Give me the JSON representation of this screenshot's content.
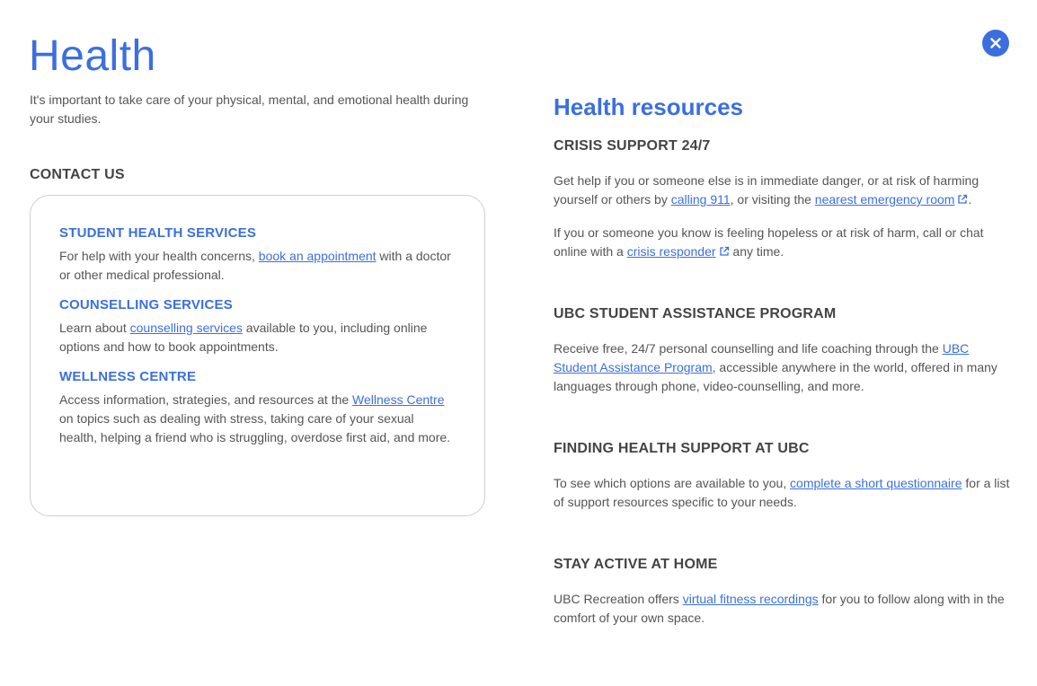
{
  "header": {
    "title": "Health",
    "close_icon": "close-icon"
  },
  "intro": "It's important to take care of your physical, mental, and emotional health during your studies.",
  "contact": {
    "heading": "CONTACT US",
    "services": [
      {
        "title": "STUDENT HEALTH SERVICES",
        "before": "For help with your health concerns, ",
        "link": "book an appointment",
        "after": " with a doctor or other medical professional."
      },
      {
        "title": "COUNSELLING SERVICES",
        "before": "Learn about ",
        "link": "counselling services",
        "after": " available to you, including online options and how to book appointments."
      },
      {
        "title": "WELLNESS CENTRE",
        "before": "Access information, strategies, and resources at the ",
        "link": "Wellness Centre",
        "after": " on topics such as dealing with stress, taking care of your sexual health, helping a friend who is struggling, overdose first aid, and more."
      }
    ]
  },
  "resources": {
    "title": "Health resources",
    "crisis": {
      "title": "CRISIS SUPPORT 24/7",
      "p1_before": "Get help if you or someone else is in immediate danger, or at risk of harming yourself or others by ",
      "p1_link1": "calling 911",
      "p1_mid": ", or visiting the ",
      "p1_link2": "nearest emergency room",
      "p1_after": ".",
      "p2_before": "If you or someone you know is feeling hopeless or at risk of harm, call or chat online with a ",
      "p2_link": "crisis responder",
      "p2_after": " any time."
    },
    "sap": {
      "title": "UBC STUDENT ASSISTANCE PROGRAM",
      "before": "Receive free, 24/7 personal counselling and life coaching through the ",
      "link": "UBC Student Assistance Program",
      "after": ", accessible anywhere in the world, offered in many languages through phone, video-counselling, and more."
    },
    "finding": {
      "title": "FINDING HEALTH SUPPORT AT UBC",
      "before": "To see which options are available to you, ",
      "link": "complete a short questionnaire",
      "after": " for a list of support resources specific to your needs."
    },
    "active": {
      "title": "STAY ACTIVE AT HOME",
      "before": "UBC Recreation offers ",
      "link": "virtual fitness recordings",
      "after": " for you to follow along with in the comfort of your own space."
    }
  },
  "colors": {
    "accent": "#3b6fe0",
    "text": "#555555",
    "heading": "#444444",
    "border": "#cfcfcf"
  }
}
